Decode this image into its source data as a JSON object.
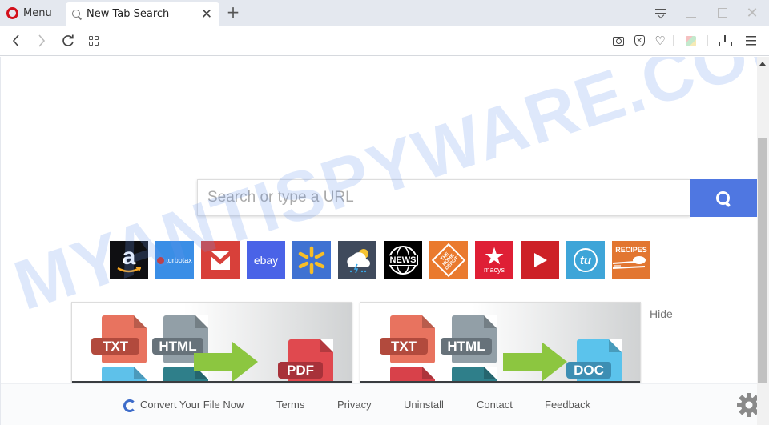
{
  "browser": {
    "menu_label": "Menu",
    "tab": {
      "title": "New Tab Search",
      "close_glyph": "✕"
    },
    "new_tab_glyph": "+",
    "window_controls": {
      "close_glyph": "✕"
    },
    "nav": {
      "back_glyph": "‹",
      "forward_glyph": "›",
      "reload_glyph": "↻"
    },
    "toolbar_icons": [
      "camera-icon",
      "adblock-icon",
      "heart-icon",
      "cube-extension-icon",
      "download-icon",
      "easy-setup-icon"
    ],
    "heart_glyph": "♡",
    "adblock_glyph": "×"
  },
  "search": {
    "placeholder": "Search or type a URL",
    "value": "",
    "button_color": "#4f77e1"
  },
  "tiles": [
    {
      "name": "amazon",
      "label": "a",
      "bg": "#0f0f12"
    },
    {
      "name": "turbotax",
      "label": "turbotax",
      "bg": "#3a8ee6"
    },
    {
      "name": "gmail",
      "label": "M",
      "bg": "#d8403a"
    },
    {
      "name": "ebay",
      "label": "ebay",
      "bg": "#4a63e7"
    },
    {
      "name": "walmart",
      "label": "✳",
      "bg": "#3f72d2"
    },
    {
      "name": "weather",
      "label": "☁",
      "bg": "#3f4a5c"
    },
    {
      "name": "news",
      "label": "NEWS",
      "bg": "#000000"
    },
    {
      "name": "home-depot",
      "label": "THE HOME DEPOT",
      "bg": "#ea7a2e"
    },
    {
      "name": "macys",
      "label": "macys",
      "bg": "#df1f35"
    },
    {
      "name": "youtube",
      "label": "▶",
      "bg": "#cd2127"
    },
    {
      "name": "tu",
      "label": "tu",
      "bg": "#3ea5d8"
    },
    {
      "name": "recipes",
      "label": "RECIPES",
      "bg": "#e27631"
    }
  ],
  "promos": [
    {
      "labels": [
        "TXT",
        "HTML",
        "PDF"
      ],
      "target_color": "#e0494f",
      "target_label_color": "#a8323a"
    },
    {
      "labels": [
        "TXT",
        "HTML",
        "DOC"
      ],
      "target_color": "#5bc3ec",
      "target_label_color": "#3d8eb3"
    }
  ],
  "hide_label": "Hide",
  "footer": {
    "convert_label": "Convert Your File Now",
    "links": [
      "Terms",
      "Privacy",
      "Uninstall",
      "Contact",
      "Feedback"
    ]
  },
  "watermark": "MYANTISPYWARE.COM"
}
